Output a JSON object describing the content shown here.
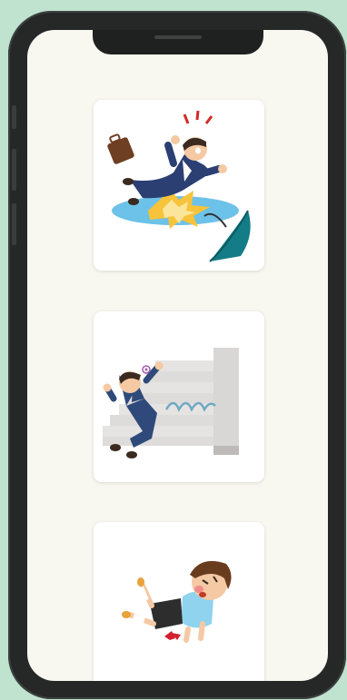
{
  "app": {
    "screen_background": "#f8f7f0",
    "frame_color": "#252827"
  },
  "cards": [
    {
      "illustration": "businessman-slipping-in-puddle-illustration",
      "color_suit": "#2c3f73",
      "color_puddle": "#6cc2e8"
    },
    {
      "illustration": "businessman-falling-down-stairs-illustration",
      "color_suit": "#2f4a7a",
      "color_stairs": "#d9d7d5"
    },
    {
      "illustration": "child-falling-illustration",
      "color_shirt": "#8fd3ee",
      "color_shorts": "#2d2d2d"
    }
  ]
}
